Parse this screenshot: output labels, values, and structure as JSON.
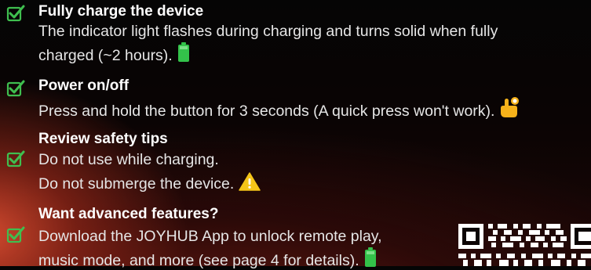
{
  "steps": [
    {
      "title": "Fully charge the device",
      "lines": [
        "The indicator light flashes during charging and turns solid when fully",
        "charged (~2 hours)."
      ],
      "icon": "battery-icon"
    },
    {
      "title": "Power on/off",
      "lines": [
        "Press and hold the button for 3 seconds (A quick press won't work)."
      ],
      "icon": "pointing-hand-icon"
    },
    {
      "title": "Review safety tips",
      "lines": [
        "Do not use while charging.",
        "Do not submerge the device."
      ],
      "icon": "warning-icon"
    },
    {
      "title": "Want advanced features?",
      "lines": [
        "Download the JOYHUB App to unlock remote play,",
        "music mode, and more (see page 4 for details)."
      ],
      "icon": "battery-icon"
    }
  ],
  "colors": {
    "check": "#3fbf4f",
    "battery": "#33c24a",
    "warning": "#f5c518",
    "hand": "#f6b21a"
  }
}
